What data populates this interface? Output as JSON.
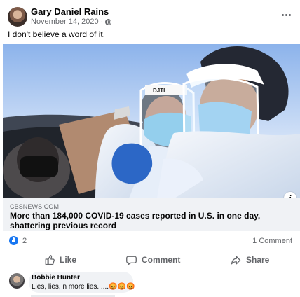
{
  "post": {
    "author": "Gary Daniel Rains",
    "date": "November 14, 2020",
    "date_separator": "·",
    "privacy_icon": "globe-icon",
    "message": "I don't believe a word of it."
  },
  "link": {
    "domain": "CBSNEWS.COM",
    "headline": "More than 184,000 COVID-19 cases reported in U.S. in one day, shattering previous record",
    "info_icon_text": "i"
  },
  "stats": {
    "reaction_count": "2",
    "comment_count": "1 Comment"
  },
  "actions": {
    "like": "Like",
    "comment": "Comment",
    "share": "Share"
  },
  "comment": {
    "author": "Bobbie Hunter",
    "text": "Lies, lies, n more lies......😡😡😡"
  },
  "colors": {
    "facebook_blue": "#1877f2",
    "secondary_text": "#65676b",
    "comment_bg": "#f0f2f5"
  }
}
